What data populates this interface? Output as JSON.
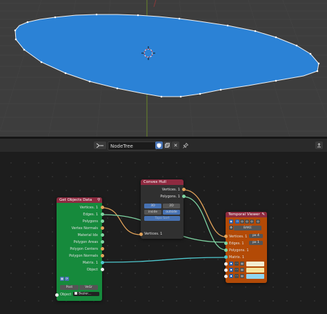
{
  "node_editor": {
    "tree_name": "NodeTree",
    "icons": [
      "node-tree-type-icon",
      "shield-check-icon",
      "copy-icon",
      "close-icon",
      "pin-icon",
      "region-toggle-icon"
    ]
  },
  "get_objects_data": {
    "title": "Get Objects Data",
    "outputs": [
      "Vertices",
      "Edges",
      "Polygons",
      "Vertex Normals",
      "Material Idx",
      "Polygon Areas",
      "Polygon Centers",
      "Polygon Normals",
      "Matrix",
      "Object"
    ],
    "counts": {
      "Vertices": "1",
      "Edges": "1",
      "Matrix": "1"
    },
    "post_label": "Post",
    "vegr_label": "VeGr",
    "object_input_label": "Object",
    "object_value": "Bezier..."
  },
  "convex_hull": {
    "title": "Convex Hull",
    "out_vertices": "Vertices. 1",
    "out_polygons": "Polygons. 1",
    "mode_3d": "3D",
    "mode_2d": "2D",
    "inside": "inside",
    "outside": "outside",
    "topo_sort": "Topo Sort",
    "in_vertices": "Vertices. 1"
  },
  "temporal_viewer": {
    "title": "Temporal Viewer",
    "bake_label": "BAKE",
    "inputs": [
      "Vertices. 1",
      "Edges. 1",
      "Polygons. 1",
      "Matrix. 1"
    ],
    "vertices_field": "px 4",
    "edges_field": "px 1",
    "swatch_colors": [
      "#f2ecd2",
      "#f4e5a0",
      "#8fd6f2"
    ]
  },
  "colors": {
    "mesh_fill": "#2b82d6",
    "node_green": "#168a3c",
    "node_gray": "#303030",
    "node_orange": "#b34a06",
    "header_maroon": "#8e2a40",
    "wire_orange": "#e2a35a",
    "wire_green": "#7fd5a3",
    "wire_teal": "#4fc9cf"
  }
}
